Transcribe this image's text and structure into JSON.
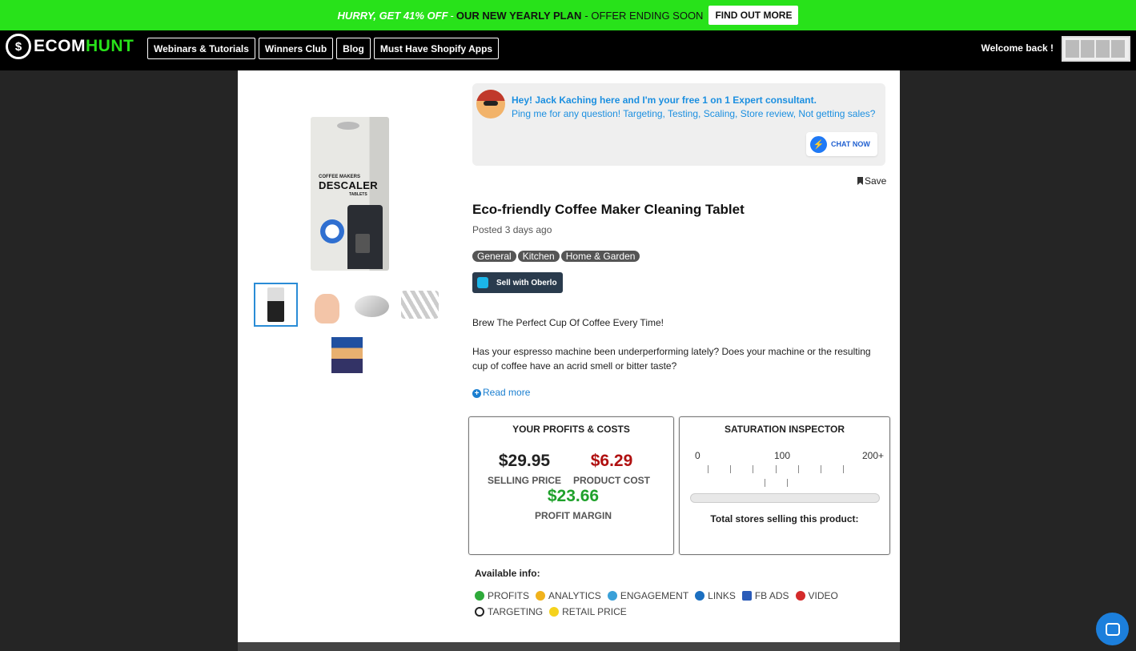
{
  "promo": {
    "hurry": "HURRY, GET 41% OFF",
    "dash": "-",
    "plan": "OUR NEW YEARLY PLAN",
    "ending": "- OFFER ENDING SOON",
    "cta": "FIND OUT MORE"
  },
  "nav": {
    "logo_eco": "ECOM",
    "logo_hunt": "HUNT",
    "logo_symbol": "$",
    "links": [
      "Webinars & Tutorials",
      "Winners Club",
      "Blog",
      "Must Have Shopify Apps"
    ],
    "welcome": "Welcome back !"
  },
  "product_image": {
    "line1": "COFFEE MAKERS",
    "line2": "DESCALER",
    "line3": "TABLETS"
  },
  "chat": {
    "line1": "Hey! Jack Kaching here and I'm your free 1 on 1 Expert consultant.",
    "line2": "Ping me for any question! Targeting, Testing, Scaling, Store review, Not getting sales?",
    "button": "CHAT NOW"
  },
  "product": {
    "save": "Save",
    "title": "Eco-friendly Coffee Maker Cleaning Tablet",
    "posted": "Posted 3 days ago",
    "tags": [
      "General",
      "Kitchen",
      "Home & Garden"
    ],
    "oberlo": "Sell with Oberlo",
    "desc1": "Brew The Perfect Cup Of Coffee Every Time!",
    "desc2": "Has your espresso machine been underperforming lately? Does your machine or the resulting cup of coffee have an acrid smell or bitter taste?",
    "read_more": "Read more"
  },
  "profits": {
    "header": "YOUR PROFITS & COSTS",
    "selling_price": "$29.95",
    "selling_label": "SELLING PRICE",
    "product_cost": "$6.29",
    "cost_label": "PRODUCT COST",
    "margin": "$23.66",
    "margin_label": "PROFIT MARGIN"
  },
  "saturation": {
    "header": "SATURATION INSPECTOR",
    "scale_min": "0",
    "scale_mid": "100",
    "scale_max": "200+",
    "footer": "Total stores selling this product:"
  },
  "available": {
    "label": "Available info:",
    "items_row1": [
      "PROFITS",
      "ANALYTICS",
      "ENGAGEMENT",
      "LINKS",
      "FB ADS",
      "VIDEO"
    ],
    "items_row2": [
      "TARGETING",
      "RETAIL PRICE"
    ]
  },
  "colors": {
    "promo_green": "#28e21a",
    "link_blue": "#1b8fe0",
    "cost_red": "#b01010",
    "margin_green": "#1fa12b"
  }
}
